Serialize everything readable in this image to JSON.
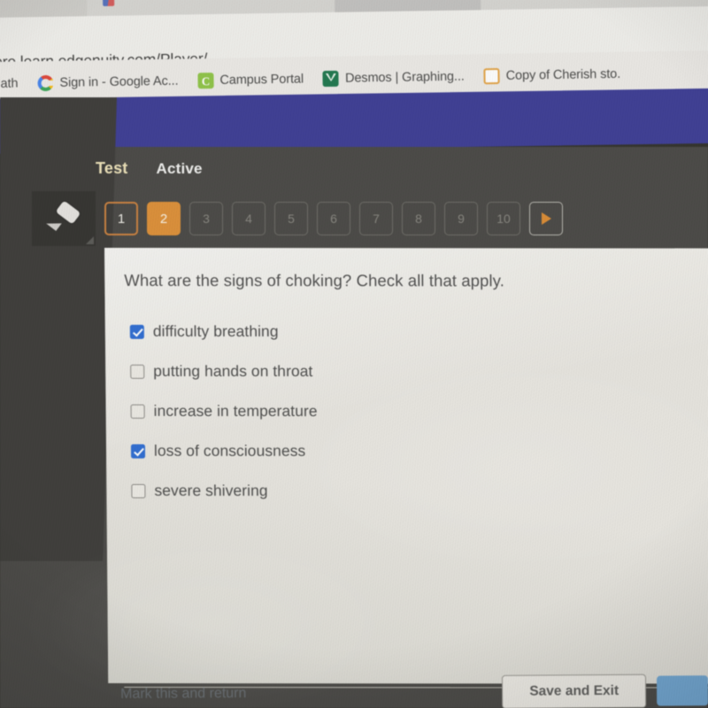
{
  "browser": {
    "url": "ore.learn.edgenuity.com/Player/",
    "tabs": [
      {
        "title": ""
      },
      {
        "title": ""
      }
    ],
    "bookmarks": [
      {
        "label": "ath",
        "icon": "generic-bookmark-icon"
      },
      {
        "label": "Sign in - Google Ac...",
        "icon": "google-icon"
      },
      {
        "label": "Campus Portal",
        "icon": "campus-portal-icon",
        "icon_letter": "C"
      },
      {
        "label": "Desmos | Graphing...",
        "icon": "desmos-icon"
      },
      {
        "label": "Copy of Cherish sto.",
        "icon": "google-docs-icon"
      }
    ]
  },
  "app": {
    "tabs": [
      {
        "label": "Test",
        "state": "selected"
      },
      {
        "label": "Active",
        "state": "normal"
      }
    ],
    "tools": {
      "highlighter_label": "Highlighter"
    },
    "question_nav": [
      {
        "label": "1",
        "state": "answered"
      },
      {
        "label": "2",
        "state": "current"
      },
      {
        "label": "3",
        "state": "locked"
      },
      {
        "label": "4",
        "state": "locked"
      },
      {
        "label": "5",
        "state": "locked"
      },
      {
        "label": "6",
        "state": "locked"
      },
      {
        "label": "7",
        "state": "locked"
      },
      {
        "label": "8",
        "state": "locked"
      },
      {
        "label": "9",
        "state": "locked"
      },
      {
        "label": "10",
        "state": "locked"
      }
    ],
    "next_button_label": "",
    "colors": {
      "accent_orange": "#e28f30",
      "nav_blue": "#3d3d9c",
      "panel_bg": "#e8e6df",
      "checkbox_blue": "#2a6edb",
      "tab_test": "#efe3b6"
    }
  },
  "question": {
    "prompt": "What are the signs of choking? Check all that apply.",
    "options": [
      {
        "label": "difficulty breathing",
        "checked": true
      },
      {
        "label": "putting hands on throat",
        "checked": false
      },
      {
        "label": "increase in temperature",
        "checked": false
      },
      {
        "label": "loss of consciousness",
        "checked": true
      },
      {
        "label": "severe shivering",
        "checked": false
      }
    ]
  },
  "footer": {
    "mark_link": "Mark this and return",
    "save_exit_label": "Save and Exit",
    "next_label": ""
  }
}
